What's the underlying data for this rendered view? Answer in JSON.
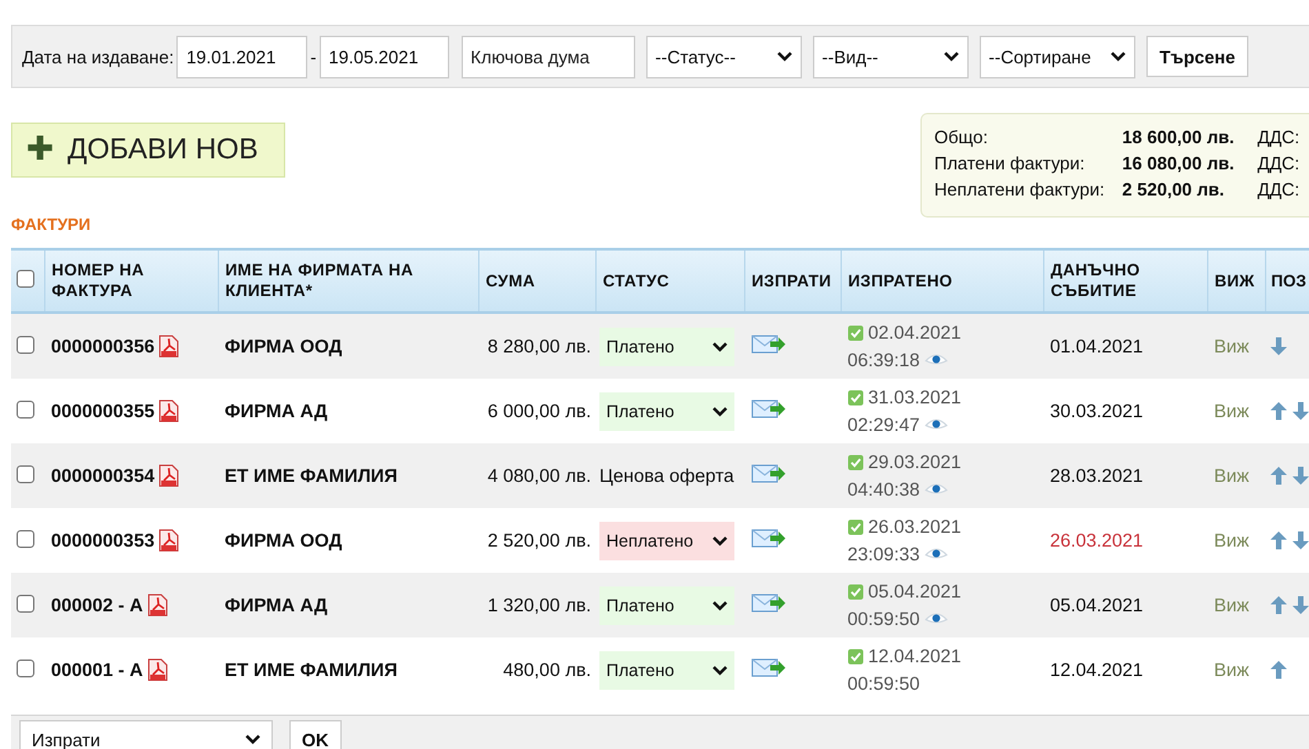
{
  "filter": {
    "date_label": "Дата на издаване:",
    "date_from": "19.01.2021",
    "separator": "-",
    "date_to": "19.05.2021",
    "keyword_placeholder": "Ключова дума",
    "selects": [
      "--Статус--",
      "--Вид--",
      "--Сортиране"
    ],
    "search_button": "Търсене"
  },
  "add_button": {
    "icon": "✚",
    "label": "ДОБАВИ НОВ"
  },
  "summary": [
    {
      "label": "Общо:",
      "value": "18 600,00 лв.",
      "extra": "ДДС:"
    },
    {
      "label": "Платени фактури:",
      "value": "16 080,00 лв.",
      "extra": "ДДС:"
    },
    {
      "label": "Неплатени фактури:",
      "value": "2 520,00 лв.",
      "extra": "ДДС:"
    }
  ],
  "section_title": "ФАКТУРИ",
  "table": {
    "select_all_checked": false,
    "columns": [
      "НОМЕР НА ФАКТУРА",
      "ИМЕ НА ФИРМАТА НА КЛИЕНТА*",
      "СУМА",
      "СТАТУС",
      "ИЗПРАТИ",
      "ИЗПРАТЕНО",
      "ДАНЪЧНО СЪБИТИЕ",
      "ВИЖ",
      "ПОЗ"
    ],
    "rows": [
      {
        "checked": false,
        "number": "0000000356",
        "client": "ФИРМА ООД",
        "amount": "8 280,00 лв.",
        "status": {
          "kind": "paid",
          "text": "Платено"
        },
        "sent_date": "02.04.2021",
        "sent_time": "06:39:18",
        "viewed": true,
        "tax_date": "01.04.2021",
        "overdue": false,
        "view": "Виж",
        "move_up": false,
        "move_down": true
      },
      {
        "checked": false,
        "number": "0000000355",
        "client": "ФИРМА АД",
        "amount": "6 000,00 лв.",
        "status": {
          "kind": "paid",
          "text": "Платено"
        },
        "sent_date": "31.03.2021",
        "sent_time": "02:29:47",
        "viewed": true,
        "tax_date": "30.03.2021",
        "overdue": false,
        "view": "Виж",
        "move_up": true,
        "move_down": true
      },
      {
        "checked": false,
        "number": "0000000354",
        "client": "ЕТ ИМЕ ФАМИЛИЯ",
        "amount": "4 080,00 лв.",
        "status": {
          "kind": "offer",
          "text": "Ценова оферта"
        },
        "sent_date": "29.03.2021",
        "sent_time": "04:40:38",
        "viewed": true,
        "tax_date": "28.03.2021",
        "overdue": false,
        "view": "Виж",
        "move_up": true,
        "move_down": true
      },
      {
        "checked": false,
        "number": "0000000353",
        "client": "ФИРМА ООД",
        "amount": "2 520,00 лв.",
        "status": {
          "kind": "unpaid",
          "text": "Неплатено"
        },
        "sent_date": "26.03.2021",
        "sent_time": "23:09:33",
        "viewed": true,
        "tax_date": "26.03.2021",
        "overdue": true,
        "view": "Виж",
        "move_up": true,
        "move_down": true
      },
      {
        "checked": false,
        "number": "000002 - А",
        "client": "ФИРМА АД",
        "amount": "1 320,00 лв.",
        "status": {
          "kind": "paid",
          "text": "Платено"
        },
        "sent_date": "05.04.2021",
        "sent_time": "00:59:50",
        "viewed": true,
        "tax_date": "05.04.2021",
        "overdue": false,
        "view": "Виж",
        "move_up": true,
        "move_down": true
      },
      {
        "checked": false,
        "number": "000001 - А",
        "client": "ЕТ ИМЕ ФАМИЛИЯ",
        "amount": "480,00 лв.",
        "status": {
          "kind": "paid",
          "text": "Платено"
        },
        "sent_date": "12.04.2021",
        "sent_time": "00:59:50",
        "viewed": false,
        "tax_date": "12.04.2021",
        "overdue": false,
        "view": "Виж",
        "move_up": true,
        "move_down": false
      }
    ]
  },
  "footer": {
    "action_select": "Изпрати",
    "ok_button": "OK"
  }
}
